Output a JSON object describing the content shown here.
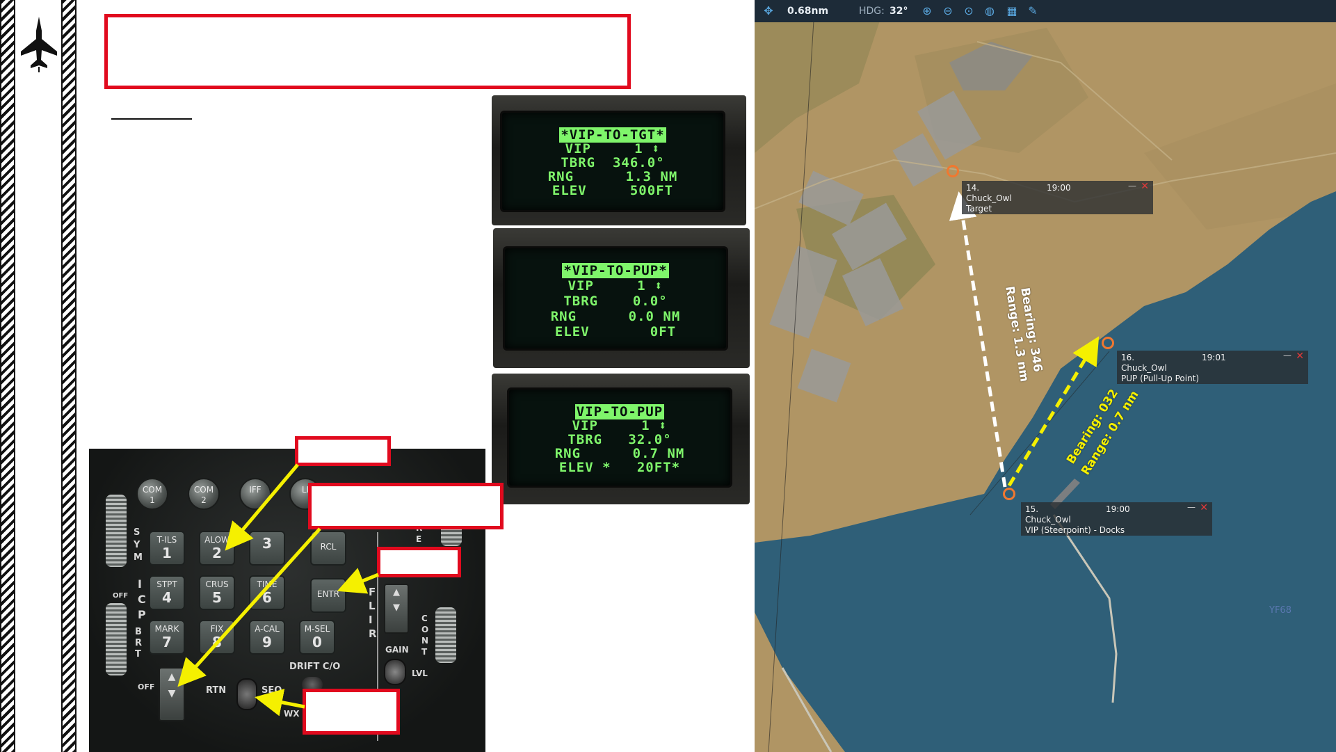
{
  "left_panel": {
    "header_box": "",
    "section_label": "",
    "callout_labels": [
      "",
      "",
      "",
      "",
      ""
    ]
  },
  "mfd_screens": [
    {
      "lines": [
        "*VIP-TO-TGT*",
        "VIP     1 ⬍",
        "TBRG  346.0°",
        "RNG      1.3 NM",
        "ELEV     500FT"
      ],
      "highlight_line": 0
    },
    {
      "lines": [
        "*VIP-TO-PUP*",
        "VIP     1 ⬍",
        "TBRG    0.0°",
        "RNG      0.0 NM",
        "ELEV       0FT"
      ],
      "highlight_line": 0
    },
    {
      "lines": [
        "VIP-TO-PUP",
        "VIP     1 ⬍",
        "TBRG   32.0°",
        "RNG      0.7 NM",
        "ELEV *   20FT*"
      ],
      "highlight_line": 0
    }
  ],
  "icp": {
    "knobs": [
      {
        "top": "COM",
        "bottom": "1"
      },
      {
        "top": "COM",
        "bottom": "2"
      },
      {
        "top": "IFF",
        "bottom": ""
      },
      {
        "top": "LI",
        "bottom": ""
      }
    ],
    "keys": [
      {
        "top": "T-ILS",
        "num": "1"
      },
      {
        "top": "ALOW",
        "num": "2"
      },
      {
        "top": "",
        "num": "3"
      },
      {
        "top": "RCL",
        "num": ""
      },
      {
        "top": "STPT",
        "num": "4"
      },
      {
        "top": "CRUS",
        "num": "5"
      },
      {
        "top": "TIME",
        "num": "6"
      },
      {
        "top": "ENTR",
        "num": ""
      },
      {
        "top": "MARK",
        "num": "7"
      },
      {
        "top": "FIX",
        "num": "8"
      },
      {
        "top": "A-CAL",
        "num": "9"
      },
      {
        "top": "M-SEL",
        "num": "0"
      }
    ],
    "labels": {
      "sym": "SYM",
      "icp": "ICP",
      "brt": "BRT",
      "off1": "OFF",
      "off2": "OFF",
      "rtn": "RTN",
      "seq": "SEQ",
      "drift": "DRIFT C/O",
      "flir": "FLIR",
      "gain": "GAIN",
      "lvl": "LVL",
      "cont": "CONT",
      "wx": "WX",
      "ref": "REF"
    }
  },
  "map": {
    "toolbar": {
      "scale": "0.68nm",
      "hdg_label": "HDG:",
      "hdg_value": "32°"
    },
    "waypoints": [
      {
        "id": "14.",
        "owner": "Chuck_Owl",
        "time": "19:00",
        "desc": "Target"
      },
      {
        "id": "16.",
        "owner": "Chuck_Owl",
        "time": "19:01",
        "desc": "PUP (Pull-Up Point)"
      },
      {
        "id": "15.",
        "owner": "Chuck_Owl",
        "time": "19:00",
        "desc": "VIP (Steerpoint) - Docks"
      }
    ],
    "white_line_labels": [
      "Bearing: 346",
      "Range: 1.3 nm"
    ],
    "yellow_line_labels": [
      "Bearing: 032",
      "Range: 0.7 nm"
    ],
    "grid_label": "YF68"
  },
  "colors": {
    "callout_red": "#e10a1e",
    "arrow_yellow": "#f5f000",
    "mfd_green": "#7ff56b",
    "waypoint_orange": "#f07830",
    "sea_blue": "#2f5f78",
    "toolbar_bg": "#1d2b38"
  }
}
